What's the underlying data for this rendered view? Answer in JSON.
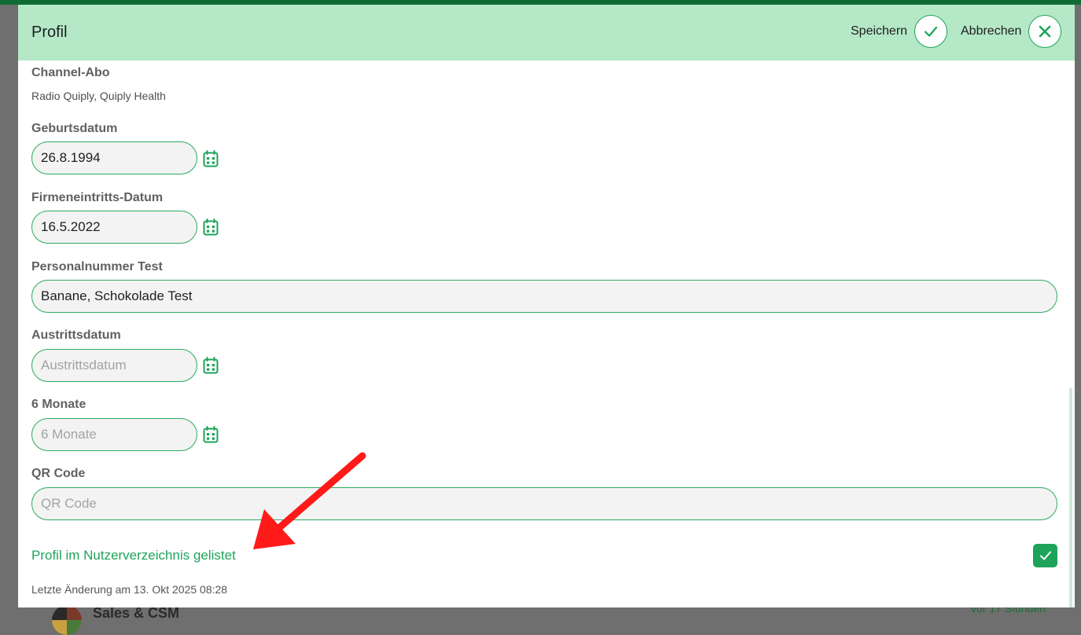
{
  "background": {
    "item_title": "Sales & CSM",
    "item_time": "vor 17 Stunden"
  },
  "modal": {
    "title": "Profil",
    "save_label": "Speichern",
    "cancel_label": "Abbrechen"
  },
  "fields": {
    "channel_abo": {
      "label": "Channel-Abo",
      "value": "Radio Quiply, Quiply Health"
    },
    "birthday": {
      "label": "Geburtsdatum",
      "value": "26.8.1994"
    },
    "entry_date": {
      "label": "Firmeneintritts-Datum",
      "value": "16.5.2022"
    },
    "personnel_number": {
      "label": "Personalnummer Test",
      "value": "Banane, Schokolade Test"
    },
    "exit_date": {
      "label": "Austrittsdatum",
      "value": "",
      "placeholder": "Austrittsdatum"
    },
    "six_months": {
      "label": "6 Monate",
      "value": "",
      "placeholder": "6 Monate"
    },
    "qr_code": {
      "label": "QR Code",
      "value": "",
      "placeholder": "QR Code"
    }
  },
  "listed": {
    "label": "Profil im Nutzerverzeichnis gelistet",
    "checked": true
  },
  "last_change": "Letzte Änderung am 13. Okt 2025 08:28",
  "icons": {
    "save": "check-icon",
    "cancel": "close-icon",
    "date_picker": "calendar-icon",
    "annotation": "red-arrow"
  },
  "colors": {
    "accent": "#1ea35b",
    "header_bg": "#b5e8c7",
    "topbar": "#0f6b34",
    "annotation_arrow": "#ff1a1a"
  }
}
